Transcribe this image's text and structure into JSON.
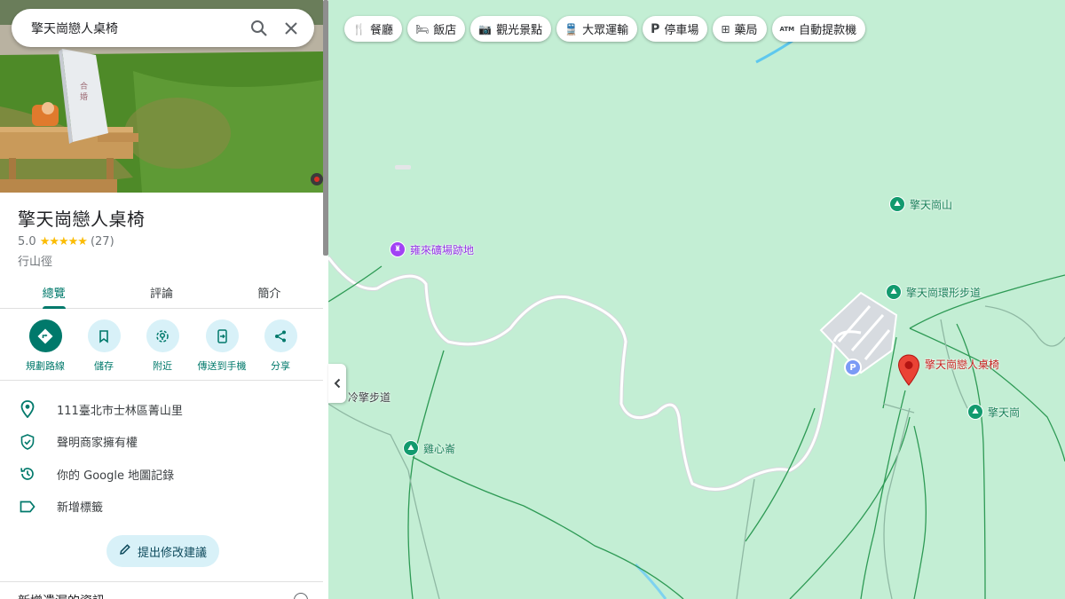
{
  "search": {
    "value": "擎天崗戀人桌椅"
  },
  "place": {
    "title": "擎天崗戀人桌椅",
    "rating": "5.0",
    "stars": "★★★★★",
    "reviews": "(27)",
    "category": "行山徑"
  },
  "tabs": [
    {
      "label": "總覽"
    },
    {
      "label": "評論"
    },
    {
      "label": "簡介"
    }
  ],
  "actions": [
    {
      "label": "規劃路線"
    },
    {
      "label": "儲存"
    },
    {
      "label": "附近"
    },
    {
      "label": "傳送到手機"
    },
    {
      "label": "分享"
    }
  ],
  "info": [
    {
      "text": "111臺北市士林區菁山里"
    },
    {
      "text": "聲明商家擁有權"
    },
    {
      "text": "你的 Google 地圖記錄"
    },
    {
      "text": "新增標籤"
    }
  ],
  "suggest_edit": "提出修改建議",
  "bottom_heading": "新增遺漏的資訊",
  "chips": [
    {
      "label": "餐廳"
    },
    {
      "label": "飯店"
    },
    {
      "label": "觀光景點"
    },
    {
      "label": "大眾運輸"
    },
    {
      "label": "停車場"
    },
    {
      "label": "藥局"
    },
    {
      "label": "自動提款機"
    }
  ],
  "parking_letter": "P",
  "map_labels": {
    "qingtian_mountain": "擎天崗山",
    "yonglai_site": "雍來礦場跡地",
    "ring_trail": "擎天崗環形步道",
    "lovers_table": "擎天崗戀人桌椅",
    "qingtiangang": "擎天崗",
    "lengqing_trail": "冷擎步道",
    "jixin_peak": "雞心崙"
  },
  "colors": {
    "accent": "#00796b",
    "map_green": "#c3eed4",
    "pin_red": "#ea4335",
    "poi_green": "#129a6e",
    "poi_purple": "#a142f4"
  }
}
